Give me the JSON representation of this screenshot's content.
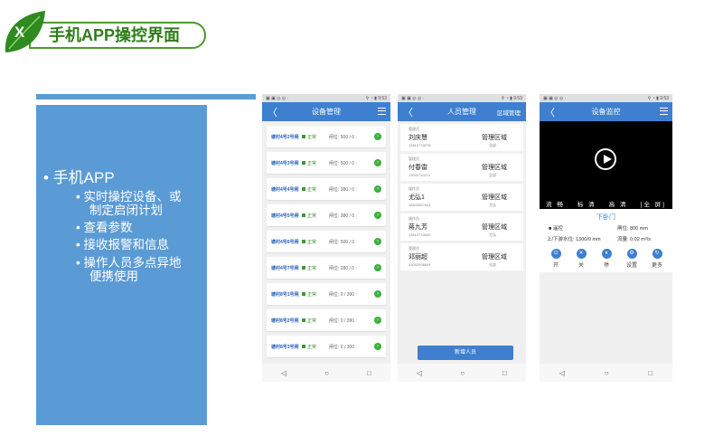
{
  "title": {
    "logo_letter": "X",
    "text": "手机APP操控界面"
  },
  "left_panel": {
    "main": "手机APP",
    "items": [
      "实时操控设备、或",
      "制定启闭计划",
      "查看参数",
      "接收报警和信息",
      "操作人员多点异地",
      "便携使用"
    ]
  },
  "status_bar": {
    "left": "▣ ▣ ◎ ◎ ·",
    "right": "⚲ ◔ ▮ 9:53"
  },
  "nav": {
    "back": "◁",
    "home": "○",
    "recent": "□"
  },
  "device_screen": {
    "header": "设备管理",
    "back": "〈",
    "status_label": "正常",
    "items": [
      {
        "name": "塘村4号2号闸",
        "gate": "闸位: 500 / 0 :"
      },
      {
        "name": "塘村4号3号闸",
        "gate": "闸位: 500 / 0 :"
      },
      {
        "name": "塘村4号4号闸",
        "gate": "闸位: 380 / 0 :"
      },
      {
        "name": "塘村4号5号闸",
        "gate": "闸位: 380 / 0 :"
      },
      {
        "name": "塘村4号6号闸",
        "gate": "闸位: 500 / 0 :"
      },
      {
        "name": "塘村4号7号闸",
        "gate": "闸位: 280 / 0 :"
      },
      {
        "name": "塘村8号1号闸",
        "gate": "闸位: 0 / 390 :"
      },
      {
        "name": "塘村8号2号闸",
        "gate": "闸位: 0 / 390 :"
      },
      {
        "name": "塘村8号3号闸",
        "gate": "闸位: 0 / 300 :"
      }
    ]
  },
  "people_screen": {
    "header": "人员管理",
    "right_link": "区域管理",
    "people": [
      {
        "role": "管理员",
        "name": "刘庆慧",
        "phone": "13810733078",
        "area": "管理区域",
        "sub": "全部"
      },
      {
        "role": "管理员",
        "name": "付春雷",
        "phone": "13002740211",
        "area": "管理区域",
        "sub": "全部"
      },
      {
        "role": "操作员",
        "name": "尤弘1",
        "phone": "18602557653",
        "area": "管理区域",
        "sub": "尤弘"
      },
      {
        "role": "操作员",
        "name": "蒋九芳",
        "phone": "13810733062",
        "area": "管理区域",
        "sub": "尤弘"
      },
      {
        "role": "管理员",
        "name": "邓丽超",
        "phone": "13052938844",
        "area": "管理区域",
        "sub": "全部"
      }
    ],
    "add_button": "新增人员"
  },
  "monitor_screen": {
    "header": "设备监控",
    "video_options": [
      "流 畅",
      "标 清",
      "高 清",
      "[全 屏]"
    ],
    "gate_title": "下卧门",
    "mode": "■ 遥控",
    "gate_pos": "闸位: 800 mm",
    "water_level": "上/下游水位: 1300/0 mm",
    "flow": "流量: 0.02 m³/s",
    "controls": [
      {
        "icon": "⏻",
        "label": "开"
      },
      {
        "icon": "✕",
        "label": "关"
      },
      {
        "icon": "⏸",
        "label": "停"
      },
      {
        "icon": "⚙",
        "label": "设置"
      },
      {
        "icon": "↻",
        "label": "更多"
      }
    ]
  }
}
